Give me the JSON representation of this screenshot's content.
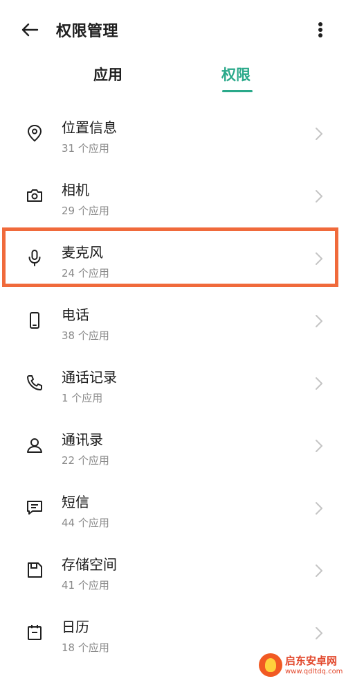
{
  "header": {
    "title": "权限管理",
    "back_icon": "arrow-left-icon",
    "more_icon": "more-vertical-icon"
  },
  "tabs": [
    {
      "label": "应用",
      "active": false
    },
    {
      "label": "权限",
      "active": true
    }
  ],
  "accent_color": "#2aa98a",
  "highlight_color": "#f06a3b",
  "permissions": [
    {
      "name": "位置信息",
      "count": "31 个应用",
      "icon": "location-pin-icon"
    },
    {
      "name": "相机",
      "count": "29 个应用",
      "icon": "camera-icon"
    },
    {
      "name": "麦克风",
      "count": "24 个应用",
      "icon": "microphone-icon"
    },
    {
      "name": "电话",
      "count": "38 个应用",
      "icon": "phone-device-icon"
    },
    {
      "name": "通话记录",
      "count": "1 个应用",
      "icon": "call-log-icon"
    },
    {
      "name": "通讯录",
      "count": "22 个应用",
      "icon": "contacts-icon"
    },
    {
      "name": "短信",
      "count": "44 个应用",
      "icon": "sms-icon"
    },
    {
      "name": "存储空间",
      "count": "41 个应用",
      "icon": "storage-icon"
    },
    {
      "name": "日历",
      "count": "18 个应用",
      "icon": "calendar-icon"
    }
  ],
  "watermark": {
    "name": "启东安卓网",
    "url": "www.qdltdq.com"
  }
}
